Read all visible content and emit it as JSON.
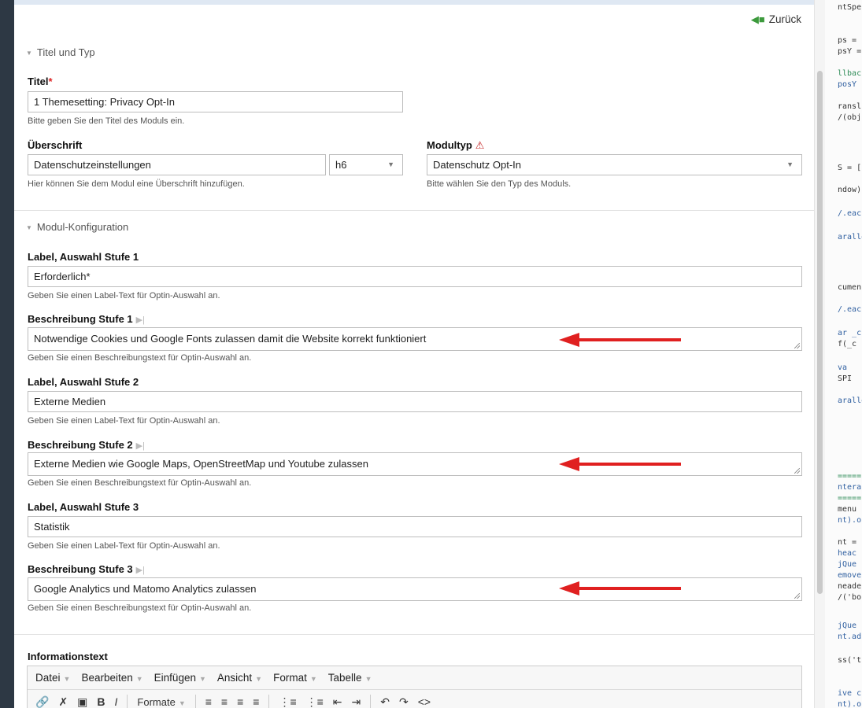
{
  "header": {
    "back_label": "Zurück"
  },
  "section_title_type": {
    "title": "Titel und Typ"
  },
  "title_field": {
    "label": "Titel",
    "required_marker": "*",
    "value": "1 Themesetting: Privacy Opt-In",
    "help": "Bitte geben Sie den Titel des Moduls ein."
  },
  "heading_field": {
    "label": "Überschrift",
    "value": "Datenschutzeinstellungen",
    "level": "h6",
    "help": "Hier können Sie dem Modul eine Überschrift hinzufügen."
  },
  "module_type": {
    "label": "Modultyp",
    "value": "Datenschutz Opt-In",
    "help": "Bitte wählen Sie den Typ des Moduls."
  },
  "section_config": {
    "title": "Modul-Konfiguration"
  },
  "config_fields": [
    {
      "label": "Label, Auswahl Stufe 1",
      "value": "Erforderlich*",
      "help": "Geben Sie einen Label-Text für Optin-Auswahl an."
    },
    {
      "label": "Beschreibung Stufe 1",
      "value": "Notwendige Cookies und Google Fonts zulassen damit die Website korrekt funktioniert",
      "help": "Geben Sie einen Beschreibungstext für Optin-Auswahl an."
    },
    {
      "label": "Label, Auswahl Stufe 2",
      "value": "Externe Medien",
      "help": "Geben Sie einen Label-Text für Optin-Auswahl an."
    },
    {
      "label": "Beschreibung Stufe 2",
      "value": "Externe Medien wie Google Maps, OpenStreetMap und Youtube zulassen",
      "help": "Geben Sie einen Beschreibungstext für Optin-Auswahl an."
    },
    {
      "label": "Label, Auswahl Stufe 3",
      "value": "Statistik",
      "help": "Geben Sie einen Label-Text für Optin-Auswahl an."
    },
    {
      "label": "Beschreibung Stufe 3",
      "value": "Google Analytics und Matomo Analytics zulassen",
      "help": "Geben Sie einen Beschreibungstext für Optin-Auswahl an."
    }
  ],
  "info_text": {
    "label": "Informationstext",
    "menu": [
      "Datei",
      "Bearbeiten",
      "Einfügen",
      "Ansicht",
      "Format",
      "Tabelle"
    ],
    "formats_label": "Formate"
  },
  "annotation_color": "#e02020",
  "code_snippet_lines": [
    "ntSpe",
    "ps = .",
    "psY =",
    "llbac",
    "posY",
    "ransl",
    "/(obj",
    "S = [",
    "ndow)",
    "/.eac",
    "aralle",
    "cumen",
    "/.eac",
    "ar _c",
    "f(_c",
    "va",
    "SPI",
    "aralle",
    "=====",
    "ntera",
    "=====",
    "menu",
    "nt).o",
    "nt = .",
    "heac",
    "jQue",
    "emove",
    "neade",
    "/('bo",
    "jQue",
    "nt.ad",
    "ss('t",
    "ive c",
    "nt).o"
  ]
}
